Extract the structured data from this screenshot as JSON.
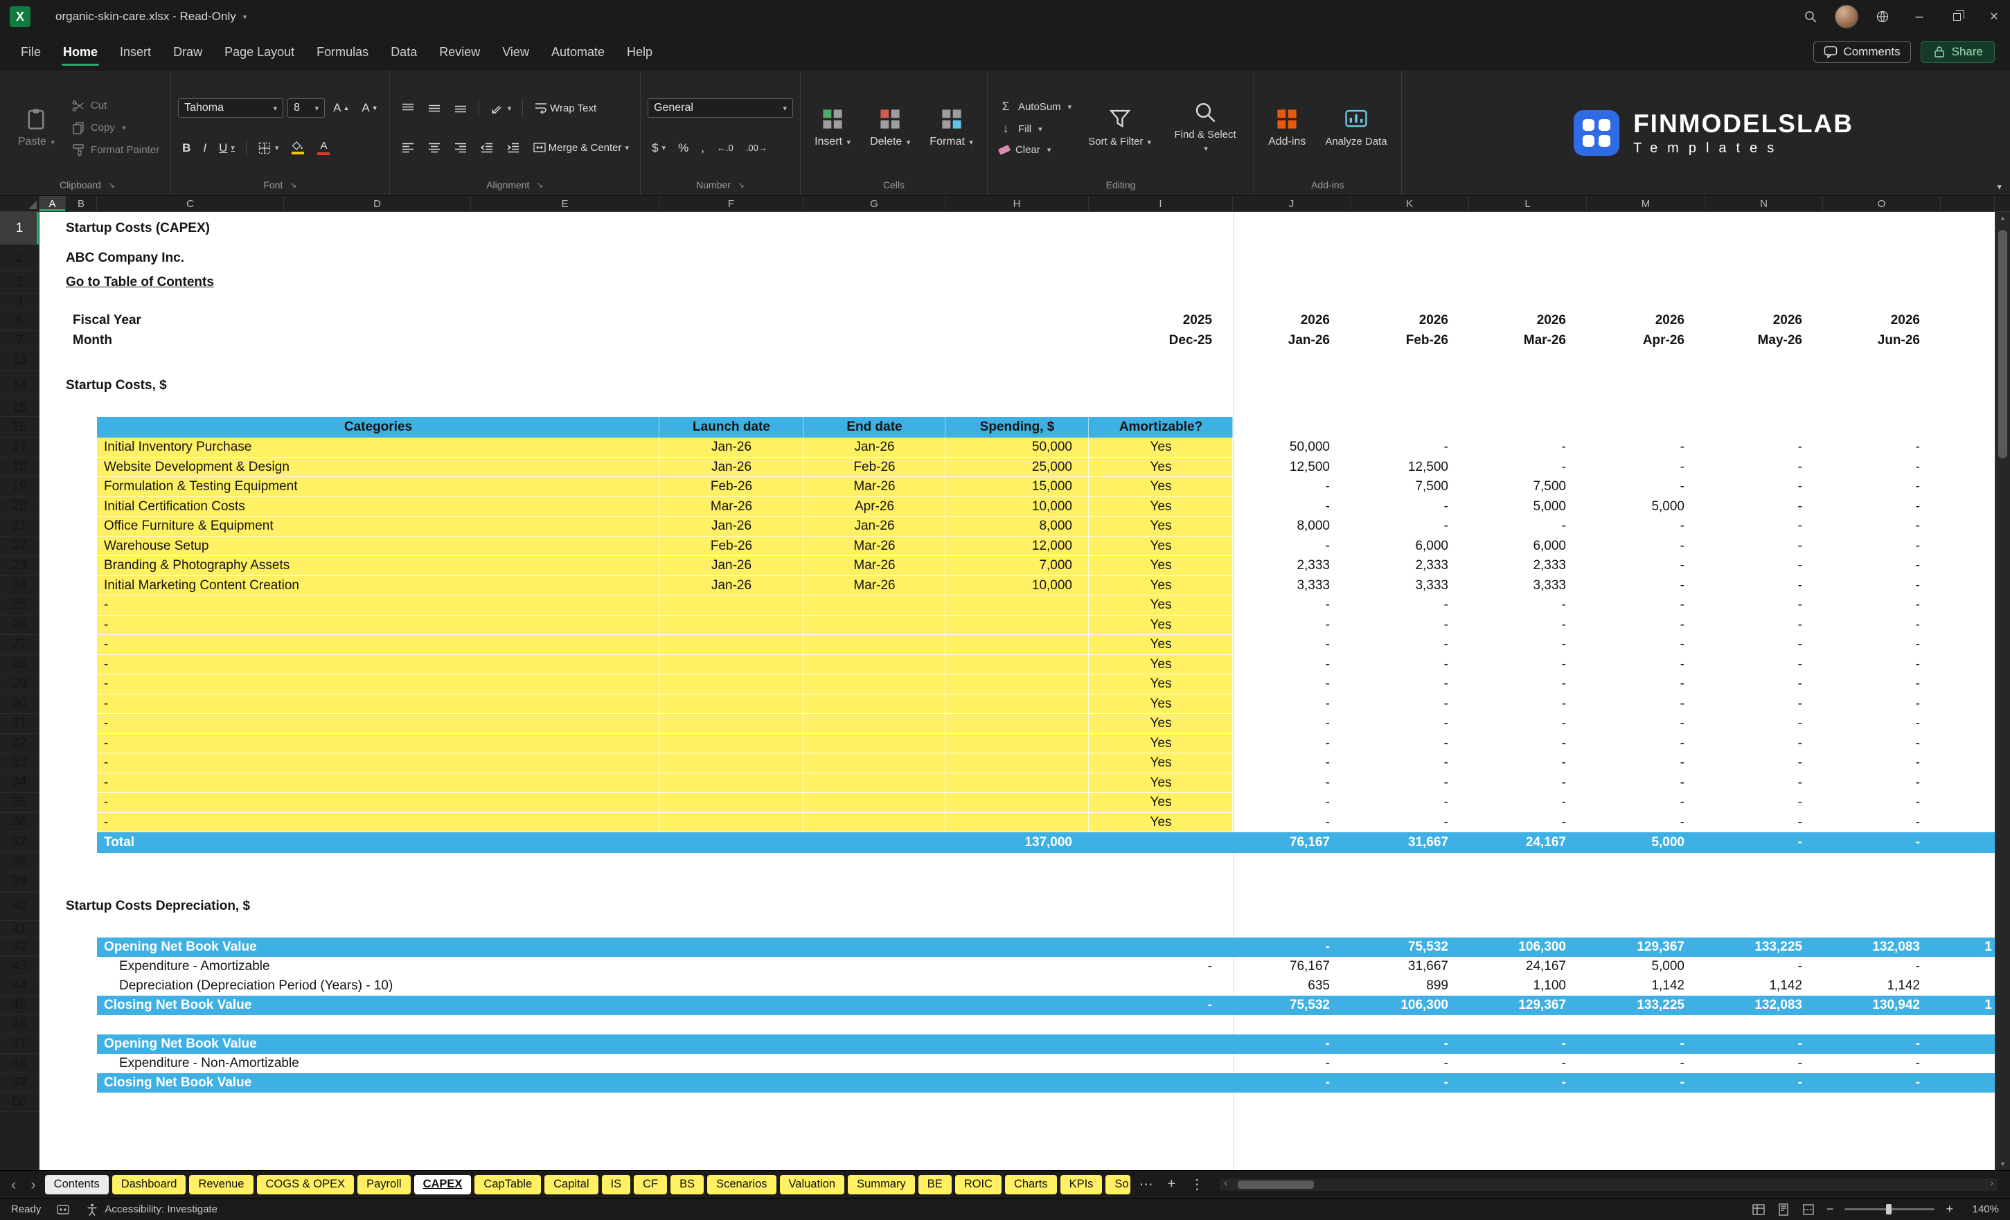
{
  "titlebar": {
    "title": "organic-skin-care.xlsx - Read-Only"
  },
  "menubar": {
    "items": [
      "File",
      "Home",
      "Insert",
      "Draw",
      "Page Layout",
      "Formulas",
      "Data",
      "Review",
      "View",
      "Automate",
      "Help"
    ],
    "comments_label": "Comments",
    "share_label": "Share"
  },
  "ribbon": {
    "paste": "Paste",
    "cut": "Cut",
    "copy": "Copy",
    "format_painter": "Format Painter",
    "clipboard_group": "Clipboard",
    "font_name": "Tahoma",
    "font_size": "8",
    "font_group": "Font",
    "wrap_text": "Wrap Text",
    "merge_center": "Merge & Center",
    "alignment_group": "Alignment",
    "number_format": "General",
    "number_group": "Number",
    "insert": "Insert",
    "delete": "Delete",
    "format": "Format",
    "cells_group": "Cells",
    "autosum": "AutoSum",
    "fill": "Fill",
    "clear": "Clear",
    "sort_filter": "Sort & Filter",
    "find_select": "Find & Select",
    "editing_group": "Editing",
    "addins": "Add-ins",
    "analyze_data": "Analyze Data",
    "addins_group": "Add-ins",
    "brand_name": "FINMODELSLAB",
    "brand_sub": "Templates"
  },
  "sheet": {
    "columns": [
      "A",
      "B",
      "C",
      "D",
      "E",
      "F",
      "G",
      "H",
      "I",
      "J",
      "K",
      "L",
      "M",
      "N",
      "O"
    ],
    "row_numbers": [
      "1",
      "2",
      "3",
      "4",
      "6",
      "7",
      "13",
      "14",
      "15",
      "16",
      "17",
      "18",
      "19",
      "20",
      "21",
      "22",
      "23",
      "24",
      "25",
      "26",
      "27",
      "28",
      "29",
      "30",
      "31",
      "32",
      "33",
      "34",
      "35",
      "36",
      "37",
      "38",
      "39",
      "40",
      "41",
      "42",
      "43",
      "44",
      "45",
      "46",
      "47",
      "48",
      "49",
      "50"
    ],
    "title": "Startup Costs (CAPEX)",
    "company": "ABC Company Inc.",
    "toc_link": "Go to Table of Contents",
    "fiscal_year_label": "Fiscal Year",
    "month_label": "Month",
    "fiscal_years": [
      "2025",
      "2026",
      "2026",
      "2026",
      "2026",
      "2026",
      "2026"
    ],
    "months": [
      "Dec-25",
      "Jan-26",
      "Feb-26",
      "Mar-26",
      "Apr-26",
      "May-26",
      "Jun-26"
    ],
    "section1_title": "Startup Costs, $",
    "capex_table": {
      "headers": [
        "Categories",
        "Launch date",
        "End date",
        "Spending, $",
        "Amortizable?"
      ],
      "rows": [
        {
          "category": "Initial Inventory Purchase",
          "launch": "Jan-26",
          "end": "Jan-26",
          "spending": "50,000",
          "amortizable": "Yes",
          "monthly": [
            "50,000",
            "-",
            "-",
            "-",
            "-",
            "-"
          ]
        },
        {
          "category": "Website Development & Design",
          "launch": "Jan-26",
          "end": "Feb-26",
          "spending": "25,000",
          "amortizable": "Yes",
          "monthly": [
            "12,500",
            "12,500",
            "-",
            "-",
            "-",
            "-"
          ]
        },
        {
          "category": "Formulation & Testing Equipment",
          "launch": "Feb-26",
          "end": "Mar-26",
          "spending": "15,000",
          "amortizable": "Yes",
          "monthly": [
            "-",
            "7,500",
            "7,500",
            "-",
            "-",
            "-"
          ]
        },
        {
          "category": "Initial Certification Costs",
          "launch": "Mar-26",
          "end": "Apr-26",
          "spending": "10,000",
          "amortizable": "Yes",
          "monthly": [
            "-",
            "-",
            "5,000",
            "5,000",
            "-",
            "-"
          ]
        },
        {
          "category": "Office Furniture & Equipment",
          "launch": "Jan-26",
          "end": "Jan-26",
          "spending": "8,000",
          "amortizable": "Yes",
          "monthly": [
            "8,000",
            "-",
            "-",
            "-",
            "-",
            "-"
          ]
        },
        {
          "category": "Warehouse Setup",
          "launch": "Feb-26",
          "end": "Mar-26",
          "spending": "12,000",
          "amortizable": "Yes",
          "monthly": [
            "-",
            "6,000",
            "6,000",
            "-",
            "-",
            "-"
          ]
        },
        {
          "category": "Branding & Photography Assets",
          "launch": "Jan-26",
          "end": "Mar-26",
          "spending": "7,000",
          "amortizable": "Yes",
          "monthly": [
            "2,333",
            "2,333",
            "2,333",
            "-",
            "-",
            "-"
          ]
        },
        {
          "category": "Initial Marketing Content Creation",
          "launch": "Jan-26",
          "end": "Mar-26",
          "spending": "10,000",
          "amortizable": "Yes",
          "monthly": [
            "3,333",
            "3,333",
            "3,333",
            "-",
            "-",
            "-"
          ]
        },
        {
          "category": "-",
          "launch": "",
          "end": "",
          "spending": "",
          "amortizable": "Yes",
          "monthly": [
            "-",
            "-",
            "-",
            "-",
            "-",
            "-"
          ]
        },
        {
          "category": "-",
          "launch": "",
          "end": "",
          "spending": "",
          "amortizable": "Yes",
          "monthly": [
            "-",
            "-",
            "-",
            "-",
            "-",
            "-"
          ]
        },
        {
          "category": "-",
          "launch": "",
          "end": "",
          "spending": "",
          "amortizable": "Yes",
          "monthly": [
            "-",
            "-",
            "-",
            "-",
            "-",
            "-"
          ]
        },
        {
          "category": "-",
          "launch": "",
          "end": "",
          "spending": "",
          "amortizable": "Yes",
          "monthly": [
            "-",
            "-",
            "-",
            "-",
            "-",
            "-"
          ]
        },
        {
          "category": "-",
          "launch": "",
          "end": "",
          "spending": "",
          "amortizable": "Yes",
          "monthly": [
            "-",
            "-",
            "-",
            "-",
            "-",
            "-"
          ]
        },
        {
          "category": "-",
          "launch": "",
          "end": "",
          "spending": "",
          "amortizable": "Yes",
          "monthly": [
            "-",
            "-",
            "-",
            "-",
            "-",
            "-"
          ]
        },
        {
          "category": "-",
          "launch": "",
          "end": "",
          "spending": "",
          "amortizable": "Yes",
          "monthly": [
            "-",
            "-",
            "-",
            "-",
            "-",
            "-"
          ]
        },
        {
          "category": "-",
          "launch": "",
          "end": "",
          "spending": "",
          "amortizable": "Yes",
          "monthly": [
            "-",
            "-",
            "-",
            "-",
            "-",
            "-"
          ]
        },
        {
          "category": "-",
          "launch": "",
          "end": "",
          "spending": "",
          "amortizable": "Yes",
          "monthly": [
            "-",
            "-",
            "-",
            "-",
            "-",
            "-"
          ]
        },
        {
          "category": "-",
          "launch": "",
          "end": "",
          "spending": "",
          "amortizable": "Yes",
          "monthly": [
            "-",
            "-",
            "-",
            "-",
            "-",
            "-"
          ]
        },
        {
          "category": "-",
          "launch": "",
          "end": "",
          "spending": "",
          "amortizable": "Yes",
          "monthly": [
            "-",
            "-",
            "-",
            "-",
            "-",
            "-"
          ]
        },
        {
          "category": "-",
          "launch": "",
          "end": "",
          "spending": "",
          "amortizable": "Yes",
          "monthly": [
            "-",
            "-",
            "-",
            "-",
            "-",
            "-"
          ]
        }
      ],
      "total_label": "Total",
      "total_spending": "137,000",
      "total_monthly": [
        "76,167",
        "31,667",
        "24,167",
        "5,000",
        "-",
        "-"
      ]
    },
    "section2_title": "Startup Costs Depreciation, $",
    "depreciation": {
      "rows": [
        {
          "label": "Opening Net Book Value",
          "style": "band",
          "dec": "",
          "monthly": [
            "-",
            "75,532",
            "106,300",
            "129,367",
            "133,225",
            "132,083"
          ],
          "partial": "1"
        },
        {
          "label": "Expenditure - Amortizable",
          "style": "plain",
          "dec": "-",
          "monthly": [
            "76,167",
            "31,667",
            "24,167",
            "5,000",
            "-",
            "-"
          ],
          "partial": ""
        },
        {
          "label": "Depreciation (Depreciation Period (Years) - 10)",
          "style": "plain",
          "dec": "",
          "monthly": [
            "635",
            "899",
            "1,100",
            "1,142",
            "1,142",
            "1,142"
          ],
          "partial": ""
        },
        {
          "label": "Closing Net Book Value",
          "style": "band",
          "dec": "-",
          "monthly": [
            "75,532",
            "106,300",
            "129,367",
            "133,225",
            "132,083",
            "130,942"
          ],
          "partial": "1"
        }
      ],
      "rows2": [
        {
          "label": "Opening Net Book Value",
          "style": "band",
          "dec": "",
          "monthly": [
            "-",
            "-",
            "-",
            "-",
            "-",
            "-"
          ],
          "partial": ""
        },
        {
          "label": "Expenditure - Non-Amortizable",
          "style": "plain",
          "dec": "",
          "monthly": [
            "-",
            "-",
            "-",
            "-",
            "-",
            "-"
          ],
          "partial": ""
        },
        {
          "label": "Closing Net Book Value",
          "style": "band",
          "dec": "",
          "monthly": [
            "-",
            "-",
            "-",
            "-",
            "-",
            "-"
          ],
          "partial": ""
        }
      ]
    }
  },
  "sheet_tabs": {
    "tabs": [
      "Contents",
      "Dashboard",
      "Revenue",
      "COGS & OPEX",
      "Payroll",
      "CAPEX",
      "CapTable",
      "Capital",
      "IS",
      "CF",
      "BS",
      "Scenarios",
      "Valuation",
      "Summary",
      "BE",
      "ROIC",
      "Charts",
      "KPIs",
      "So"
    ]
  },
  "statusbar": {
    "ready": "Ready",
    "accessibility": "Accessibility: Investigate",
    "zoom": "140%"
  },
  "colors": {
    "band_blue": "#3FB0E4",
    "cell_yellow": "#FFF064",
    "link_blue": "#2E75D4",
    "brand_blue": "#2F6BE4",
    "accent_green": "#2EA36B",
    "tab_yellow": "#FFF064"
  }
}
